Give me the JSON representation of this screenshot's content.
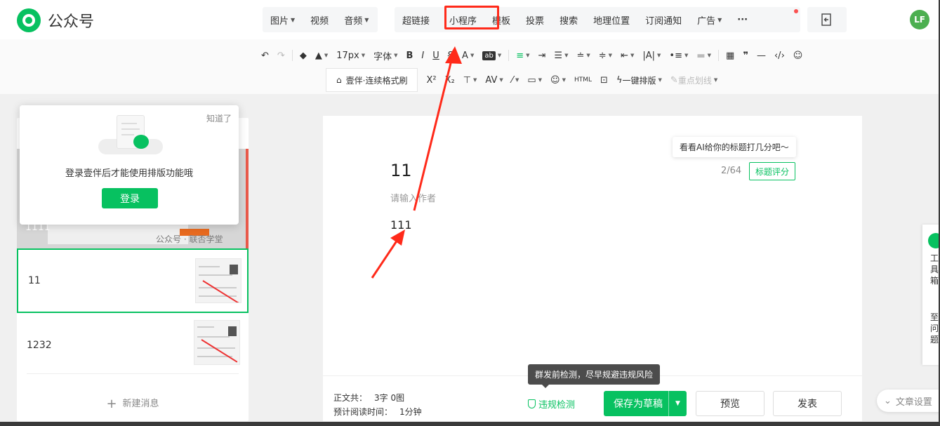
{
  "brand": {
    "name": "公众号"
  },
  "header": {
    "menu_group1": [
      {
        "label": "图片",
        "caret": true
      },
      {
        "label": "视频",
        "caret": false
      },
      {
        "label": "音频",
        "caret": true
      }
    ],
    "menu_group2": [
      {
        "label": "超链接",
        "caret": false
      },
      {
        "label": "小程序",
        "caret": false
      },
      {
        "label": "模板",
        "caret": false
      },
      {
        "label": "投票",
        "caret": false
      },
      {
        "label": "搜索",
        "caret": false
      },
      {
        "label": "地理位置",
        "caret": false
      },
      {
        "label": "订阅通知",
        "caret": false
      },
      {
        "label": "广告",
        "caret": true
      },
      {
        "label": "···",
        "caret": false
      }
    ],
    "avatar_text": "LF"
  },
  "toolbar": {
    "font_size": "17px",
    "font_family": "字体",
    "format_painter": "壹伴·连续格式刷",
    "one_click_layout": "一键排版",
    "highlight_line": "重点划线"
  },
  "popover": {
    "dismiss": "知道了",
    "message": "登录壹伴后才能使用排版功能哦",
    "login_button": "登录"
  },
  "articles": {
    "cover_title": "1111",
    "cover_watermark": "公众号 · 联否学堂",
    "items": [
      {
        "title": "11"
      },
      {
        "title": "1232"
      }
    ],
    "new_message": "新建消息"
  },
  "editor": {
    "ai_tip": "看看AI给你的标题打几分吧～",
    "title": "11",
    "title_count": "2/64",
    "score_button": "标题评分",
    "author_placeholder": "请输入作者",
    "body": "111"
  },
  "footer": {
    "stat_word_label": "正文共：",
    "stat_word_value": "3字 0图",
    "stat_time_label": "预计阅读时间：",
    "stat_time_value": "1分钟",
    "check_tip": "群发前检测，尽早规避违规风险",
    "check_link": "违规检测",
    "save_draft": "保存为草稿",
    "preview": "预览",
    "publish": "发表",
    "article_settings": "文章设置"
  },
  "colors": {
    "accent": "#07c160",
    "annotation_red": "#ff2a1a"
  }
}
